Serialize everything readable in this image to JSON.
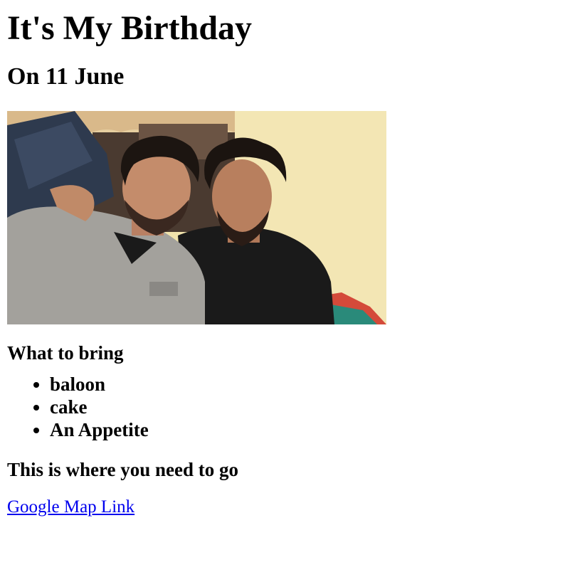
{
  "page": {
    "title": "It's My Birthday",
    "date": "On 11 June",
    "bring_heading": "What to bring",
    "bring_items": [
      "baloon",
      "cake",
      "An Appetite"
    ],
    "location_heading": "This is where you need to go",
    "map_link_text": "Google Map Link"
  },
  "photo": {
    "subject": "Selfie of two young men with curly dark hair"
  },
  "colors": {
    "link": "#0000ee",
    "text": "#000000",
    "background": "#ffffff"
  }
}
